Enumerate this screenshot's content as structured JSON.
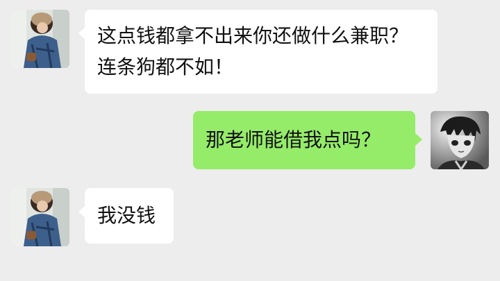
{
  "conversation": {
    "messages": [
      {
        "sender": "other",
        "avatar": "girl-avatar",
        "text": "这点钱都拿不出来你还做什么兼职？连条狗都不如！"
      },
      {
        "sender": "self",
        "avatar": "anime-boy-avatar",
        "text": "那老师能借我点吗？"
      },
      {
        "sender": "other",
        "avatar": "girl-avatar",
        "text": "我没钱"
      }
    ]
  },
  "colors": {
    "background": "#ededed",
    "incoming_bubble": "#ffffff",
    "outgoing_bubble": "#95ec69",
    "text": "#111111"
  }
}
